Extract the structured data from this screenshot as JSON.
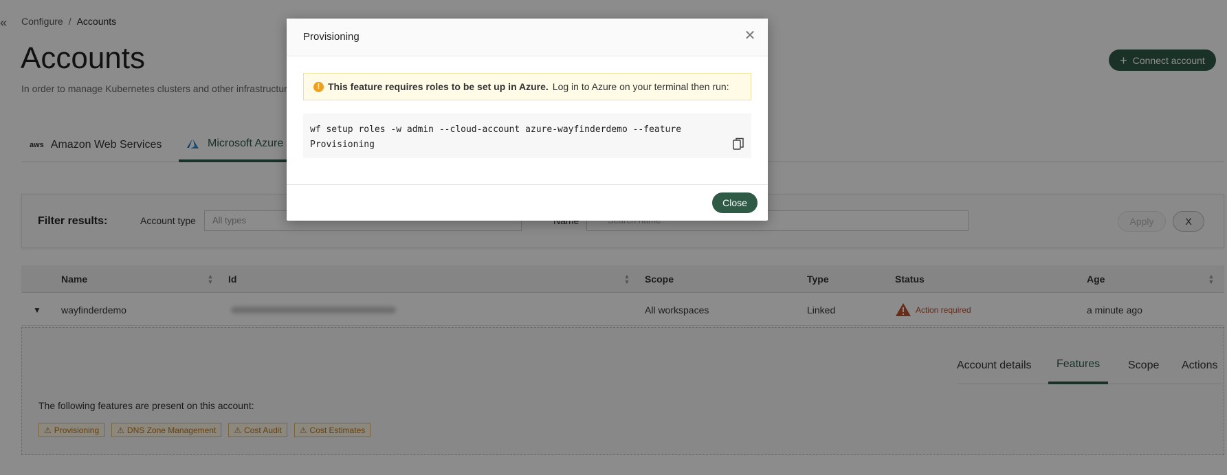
{
  "breadcrumb": {
    "parent": "Configure",
    "separator": "/",
    "current": "Accounts"
  },
  "page": {
    "title": "Accounts",
    "description": "In order to manage Kubernetes clusters and other infrastructure",
    "connect_button": "Connect account"
  },
  "tabs": [
    {
      "label": "Amazon Web Services",
      "logo": "aws"
    },
    {
      "label": "Microsoft Azure",
      "logo": "azure"
    }
  ],
  "filter": {
    "title": "Filter results:",
    "account_type_label": "Account type",
    "account_type_placeholder": "All types",
    "name_label": "Name",
    "name_placeholder": "Search name",
    "apply_label": "Apply",
    "clear_label": "X"
  },
  "table": {
    "columns": [
      "Name",
      "Id",
      "Scope",
      "Type",
      "Status",
      "Age"
    ],
    "rows": [
      {
        "name": "wayfinderdemo",
        "scope": "All workspaces",
        "type": "Linked",
        "status": "Action required",
        "age": "a minute ago"
      }
    ]
  },
  "details": {
    "tabs": [
      "Account details",
      "Features",
      "Scope",
      "Actions"
    ],
    "features_text": "The following features are present on this account:",
    "features": [
      "Provisioning",
      "DNS Zone Management",
      "Cost Audit",
      "Cost Estimates"
    ]
  },
  "modal": {
    "title": "Provisioning",
    "alert_bold": "This feature requires roles to be set up in Azure.",
    "alert_text": "Log in to Azure on your terminal then run:",
    "command": "wf setup roles -w admin --cloud-account azure-wayfinderdemo --feature\nProvisioning",
    "close_label": "Close"
  },
  "colors": {
    "accent": "#2f5a46",
    "warning": "#c0502a",
    "chip": "#b8751a",
    "alert_bg": "#fffbe6"
  }
}
